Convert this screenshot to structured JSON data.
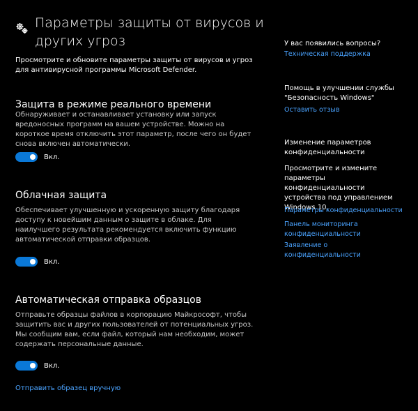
{
  "header": {
    "title": "Параметры защиты от вирусов и других угроз",
    "icon": "gear-icon",
    "intro": "Просмотрите и обновите параметры защиты от вирусов и угроз для антивирусной программы Microsoft Defender."
  },
  "sections": [
    {
      "title": "Защита в режиме реального времени",
      "description": "Обнаруживает и останавливает установку или запуск вредоносных программ на вашем устройстве. Можно на короткое время отключить этот параметр, после чего он будет снова включен автоматически.",
      "toggle_label": "Вкл.",
      "toggle_on": true
    },
    {
      "title": "Облачная защита",
      "description": "Обеспечивает улучшенную и ускоренную защиту благодаря доступу к новейшим данным о защите в облаке. Для наилучшего результата рекомендуется включить функцию автоматической отправки образцов.",
      "toggle_label": "Вкл.",
      "toggle_on": true
    },
    {
      "title": "Автоматическая отправка образцов",
      "description": "Отправьте образцы файлов в корпорацию Майкрософт, чтобы защитить вас и других пользователей от потенциальных угроз. Мы сообщим вам, если файл, который нам необходим, может содержать персональные данные.",
      "toggle_label": "Вкл.",
      "toggle_on": true
    }
  ],
  "submit_sample_link": "Отправить образец вручную",
  "sidebar": {
    "questions_heading": "У вас появились вопросы?",
    "support_link": "Техническая поддержка",
    "improve_heading": "Помощь в улучшении службы \"Безопасность Windows\"",
    "feedback_link": "Оставить отзыв",
    "privacy_heading": "Изменение параметров конфиденциальности",
    "privacy_text": "Просмотрите и измените параметры конфиденциальности устройства под управлением Windows 10.",
    "privacy_settings_link": "Параметры конфиденциальности",
    "privacy_dashboard_link": "Панель мониторинга конфиденциальности",
    "privacy_statement_link": "Заявление о конфиденциальности"
  },
  "colors": {
    "accent": "#0a78d7",
    "link": "#4aa3ff",
    "background": "#000000"
  }
}
